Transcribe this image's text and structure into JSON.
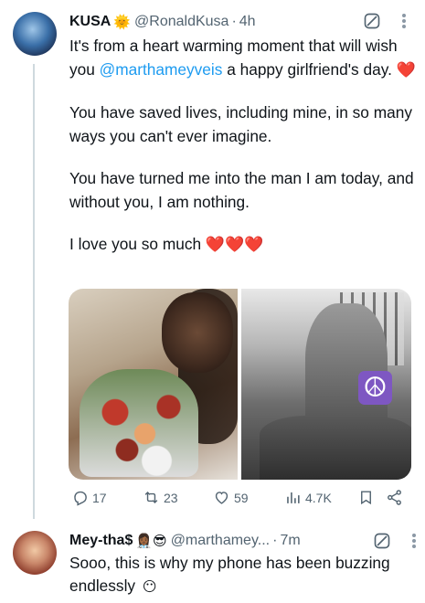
{
  "tweet": {
    "display_name": "KUSA",
    "name_emoji": "🌞",
    "handle": "@RonaldKusa",
    "separator": "·",
    "time": "4h",
    "more_icon": "more-dots-icon",
    "line1_a": "It's from a heart warming moment that will wish you ",
    "mention": "@marthameyveis",
    "line1_b": " a happy girlfriend's day. ",
    "heart": "❤️",
    "para2": "You have saved lives, including mine, in so many ways you can't ever imagine.",
    "para3": "You have turned me into the man I am today, and without you, I am nothing.",
    "para4": "I love you so much ",
    "hearts": "❤️❤️❤️",
    "peace_symbol": "☮",
    "actions": {
      "replies": "17",
      "retweets": "23",
      "likes": "59",
      "views": "4.7K"
    }
  },
  "reply": {
    "display_name": "Mey-tha$",
    "name_emoji": "👩🏾‍⚕️😎",
    "handle": "@marthamey...",
    "separator": "·",
    "time": "7m",
    "text": "Sooo, this is why my phone has been buzzing endlessly ",
    "text_emoji": "😶"
  },
  "colors": {
    "link": "#1d9bf0",
    "muted": "#536471",
    "heart": "#e0245e",
    "thread_line": "#cfd9de"
  }
}
